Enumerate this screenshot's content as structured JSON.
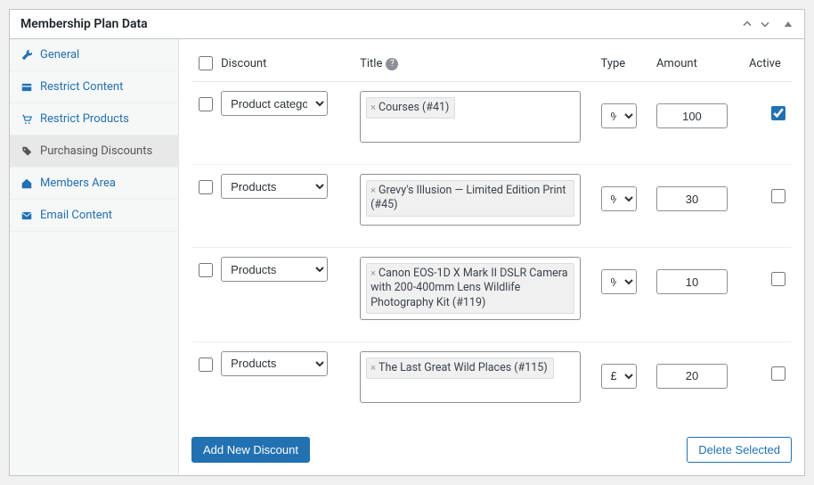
{
  "panel": {
    "title": "Membership Plan Data"
  },
  "tabs": [
    {
      "label": "General"
    },
    {
      "label": "Restrict Content"
    },
    {
      "label": "Restrict Products"
    },
    {
      "label": "Purchasing Discounts"
    },
    {
      "label": "Members Area"
    },
    {
      "label": "Email Content"
    }
  ],
  "columns": {
    "discount": "Discount",
    "title": "Title",
    "type": "Type",
    "amount": "Amount",
    "active": "Active"
  },
  "discount_options": {
    "product_categories": "Product categories",
    "products": "Products"
  },
  "type_options": {
    "percent": "%",
    "pound": "£"
  },
  "rows": [
    {
      "discount": "product_categories",
      "title_token": "Courses (#41)",
      "type": "percent",
      "amount": "100",
      "active": true
    },
    {
      "discount": "products",
      "title_token": "Grevy's Illusion — Limited Edition Print (#45)",
      "type": "percent",
      "amount": "30",
      "active": false
    },
    {
      "discount": "products",
      "title_token": "Canon EOS-1D X Mark II DSLR Camera with 200-400mm Lens Wildlife Photography Kit (#119)",
      "type": "percent",
      "amount": "10",
      "active": false
    },
    {
      "discount": "products",
      "title_token": "The Last Great Wild Places (#115)",
      "type": "pound",
      "amount": "20",
      "active": false
    }
  ],
  "buttons": {
    "add": "Add New Discount",
    "delete": "Delete Selected"
  }
}
